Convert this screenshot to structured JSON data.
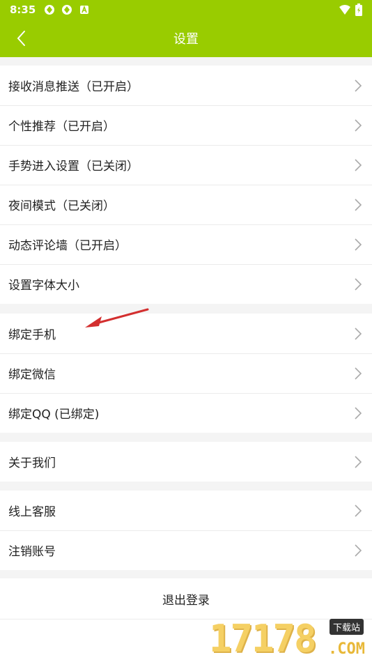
{
  "status_bar": {
    "time": "8:35"
  },
  "header": {
    "title": "设置"
  },
  "sections": [
    [
      "接收消息推送（已开启）",
      "个性推荐（已开启）",
      "手势进入设置（已关闭）",
      "夜间模式（已关闭）",
      "动态评论墙（已开启）",
      "设置字体大小"
    ],
    [
      "绑定手机",
      "绑定微信",
      "绑定QQ (已绑定)"
    ],
    [
      "关于我们"
    ],
    [
      "线上客服",
      "注销账号"
    ]
  ],
  "logout": {
    "label": "退出登录"
  },
  "watermark": {
    "digits": "17178",
    "tag": "下载站",
    "domain": ".COM"
  },
  "colors": {
    "header_bg": "#99cc00",
    "annotation_arrow": "#d32f2f"
  }
}
